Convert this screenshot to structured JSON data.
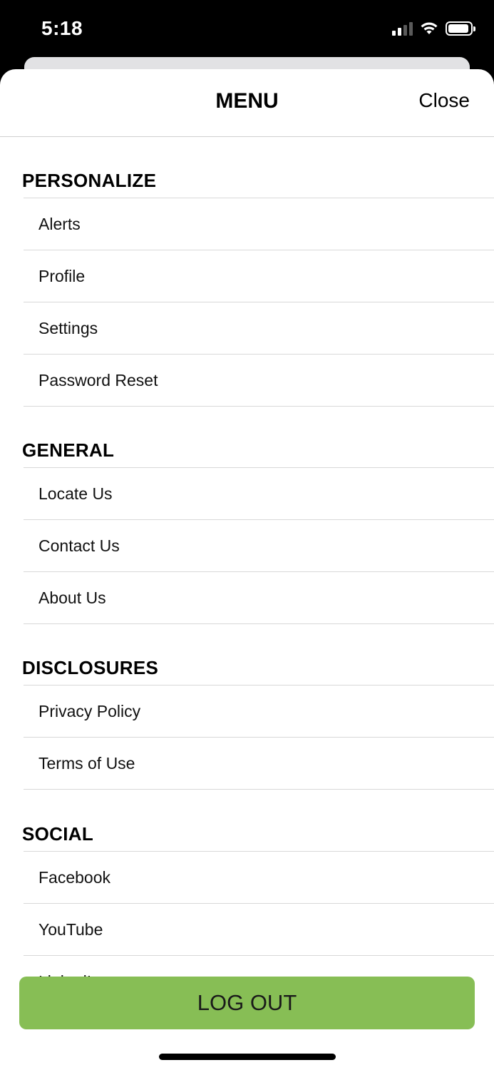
{
  "status_bar": {
    "time": "5:18",
    "icons": [
      "cellular-signal-icon",
      "wifi-icon",
      "battery-icon"
    ]
  },
  "header": {
    "title": "MENU",
    "close_label": "Close"
  },
  "sections": [
    {
      "title": "PERSONALIZE",
      "items": [
        "Alerts",
        "Profile",
        "Settings",
        "Password Reset"
      ]
    },
    {
      "title": "GENERAL",
      "items": [
        "Locate Us",
        "Contact Us",
        "About Us"
      ]
    },
    {
      "title": "DISCLOSURES",
      "items": [
        "Privacy Policy",
        "Terms of Use"
      ]
    },
    {
      "title": "SOCIAL",
      "items": [
        "Facebook",
        "YouTube",
        "LinkedIn"
      ]
    }
  ],
  "logout": {
    "label": "LOG OUT",
    "color": "#87be55"
  }
}
